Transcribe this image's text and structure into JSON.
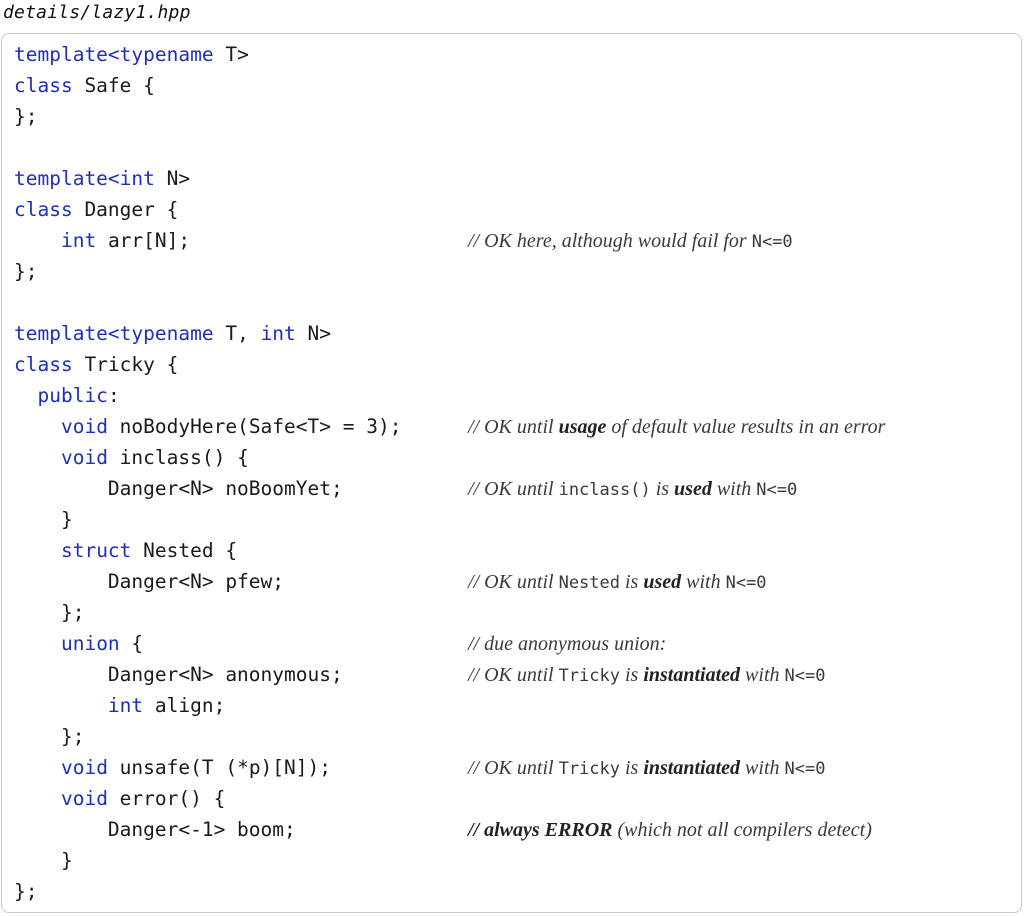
{
  "filename": "details/lazy1.hpp",
  "code": {
    "l1_kw": "template<typename",
    "l1_rest": " T>",
    "l2_kw": "class",
    "l2_rest": " Safe {",
    "l3": "};",
    "l5_kw": "template<int",
    "l5_rest": " N>",
    "l6_kw": "class",
    "l6_rest": " Danger {",
    "l7_indent": "    ",
    "l7_kw": "int",
    "l7_rest": " arr[N];",
    "l8": "};",
    "l10_kw1": "template<typename",
    "l10_mid": " T, ",
    "l10_kw2": "int",
    "l10_rest": " N>",
    "l11_kw": "class",
    "l11_rest": " Tricky {",
    "l12_indent": "  ",
    "l12_kw": "public",
    "l12_rest": ":",
    "l13_indent": "    ",
    "l13_kw": "void",
    "l13_rest": " noBodyHere(Safe<T> = 3);",
    "l14_indent": "    ",
    "l14_kw": "void",
    "l14_rest": " inclass() {",
    "l15": "        Danger<N> noBoomYet;",
    "l16": "    }",
    "l17_indent": "    ",
    "l17_kw": "struct",
    "l17_rest": " Nested {",
    "l18": "        Danger<N> pfew;",
    "l19": "    };",
    "l20_indent": "    ",
    "l20_kw": "union",
    "l20_rest": " {",
    "l21": "        Danger<N> anonymous;",
    "l22_indent": "        ",
    "l22_kw": "int",
    "l22_rest": " align;",
    "l23": "    };",
    "l24_indent": "    ",
    "l24_kw": "void",
    "l24_rest": " unsafe(T (*p)[N]);",
    "l25_indent": "    ",
    "l25_kw": "void",
    "l25_rest": " error() {",
    "l26": "        Danger<-1> boom;",
    "l27": "    }",
    "l28": "};"
  },
  "comments": {
    "c7_a": "// OK here, although would fail for ",
    "c7_code": "N<=0",
    "c13_a": "// OK until ",
    "c13_em": "usage",
    "c13_b": " of default value results in an error",
    "c15_a": "// OK until ",
    "c15_code1": "inclass()",
    "c15_b": " is ",
    "c15_em": "used",
    "c15_c": " with ",
    "c15_code2": "N<=0",
    "c18_a": "// OK until ",
    "c18_code1": "Nested",
    "c18_b": " is ",
    "c18_em": "used",
    "c18_c": " with ",
    "c18_code2": "N<=0",
    "c20": "// due anonymous union:",
    "c21_a": "// OK until ",
    "c21_code1": "Tricky",
    "c21_b": " is ",
    "c21_em": "instantiated",
    "c21_c": " with ",
    "c21_code2": "N<=0",
    "c24_a": "// OK until ",
    "c24_code1": "Tricky",
    "c24_b": " is ",
    "c24_em": "instantiated",
    "c24_c": " with ",
    "c24_code2": "N<=0",
    "c26_em": "// always ERROR",
    "c26_b": " (which not all compilers detect)"
  },
  "colors": {
    "keyword": "#1f2fb8",
    "text": "#1a1a1a",
    "comment": "#3a3a3a",
    "border": "#c9c9c9"
  }
}
